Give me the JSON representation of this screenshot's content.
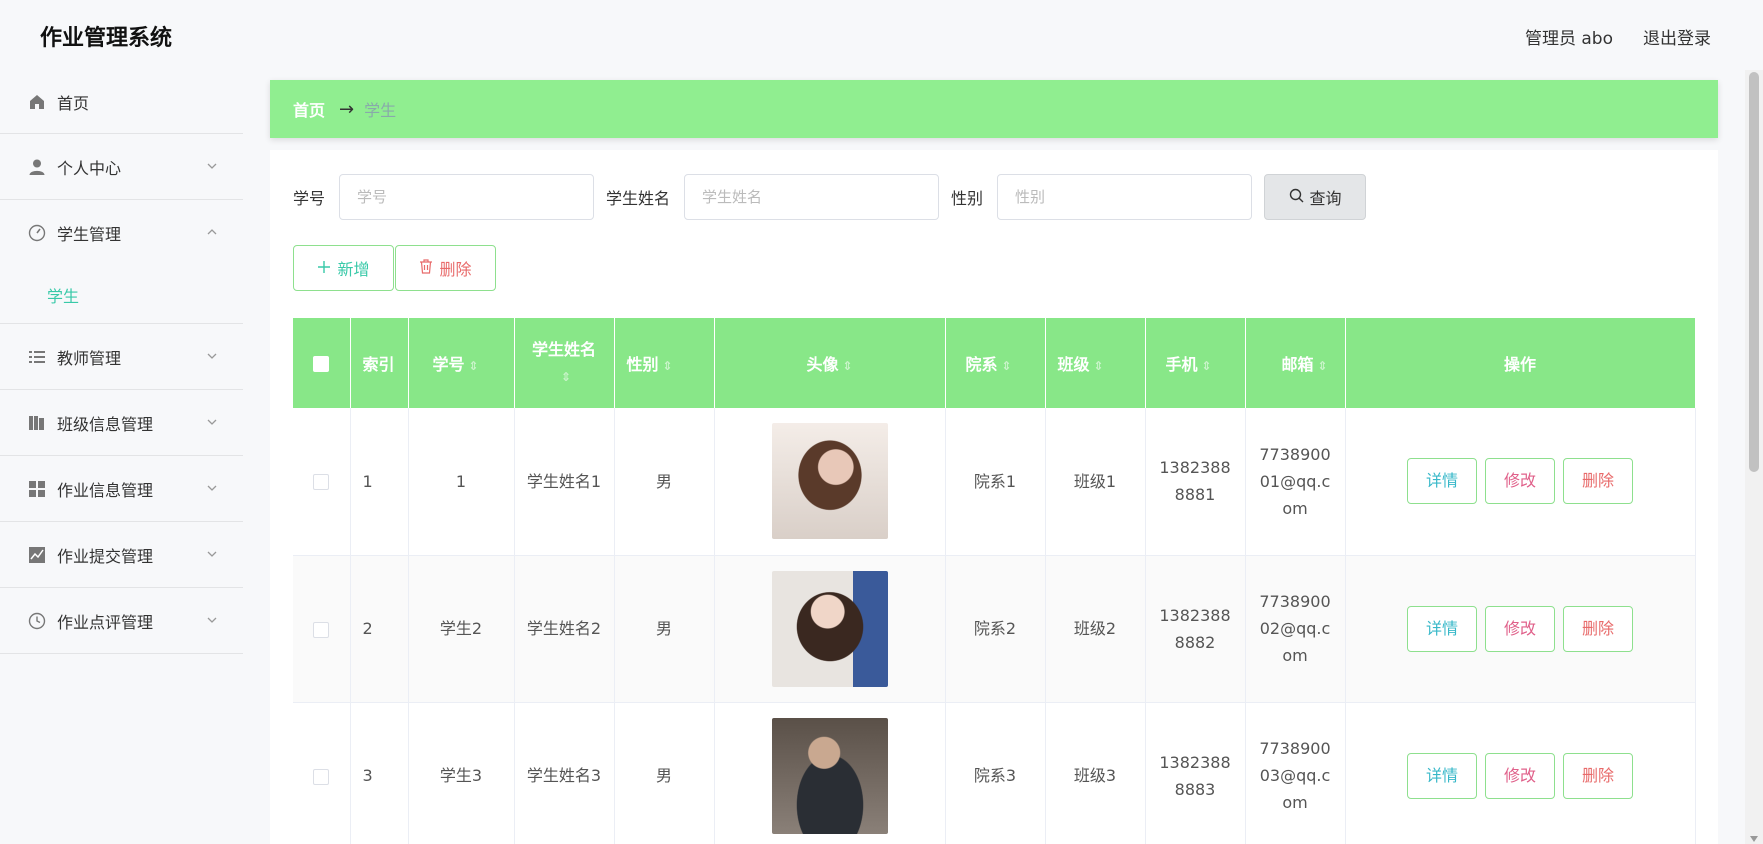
{
  "app": {
    "title": "作业管理系统"
  },
  "header": {
    "user_label": "管理员 abo",
    "logout_label": "退出登录"
  },
  "sidebar": {
    "items": [
      {
        "label": "首页"
      },
      {
        "label": "个人中心"
      },
      {
        "label": "学生管理",
        "children": [
          {
            "label": "学生"
          }
        ]
      },
      {
        "label": "教师管理"
      },
      {
        "label": "班级信息管理"
      },
      {
        "label": "作业信息管理"
      },
      {
        "label": "作业提交管理"
      },
      {
        "label": "作业点评管理"
      }
    ]
  },
  "breadcrumb": {
    "home": "首页",
    "arrow": "→",
    "current": "学生"
  },
  "search": {
    "student_no": {
      "label": "学号",
      "placeholder": "学号",
      "value": ""
    },
    "student_name": {
      "label": "学生姓名",
      "placeholder": "学生姓名",
      "value": ""
    },
    "gender": {
      "label": "性别",
      "placeholder": "性别",
      "value": ""
    },
    "query_label": "查询"
  },
  "actions": {
    "add_label": "新增",
    "delete_label": "删除"
  },
  "table": {
    "headers": [
      "索引",
      "学号",
      "学生姓名",
      "性别",
      "头像",
      "院系",
      "班级",
      "手机",
      "邮箱",
      "操作"
    ],
    "rows": [
      {
        "index": "1",
        "no": "1",
        "name": "学生姓名1",
        "gender": "男",
        "dept": "院系1",
        "class": "班级1",
        "phone": "13823888881",
        "email": "773890001@qq.com"
      },
      {
        "index": "2",
        "no": "学生2",
        "name": "学生姓名2",
        "gender": "男",
        "dept": "院系2",
        "class": "班级2",
        "phone": "13823888882",
        "email": "773890002@qq.com"
      },
      {
        "index": "3",
        "no": "学生3",
        "name": "学生姓名3",
        "gender": "男",
        "dept": "院系3",
        "class": "班级3",
        "phone": "13823888883",
        "email": "773890003@qq.com"
      }
    ],
    "row_actions": {
      "detail": "详情",
      "edit": "修改",
      "delete": "删除"
    }
  },
  "colors": {
    "accent_green": "#90ee90",
    "header_green": "#88e788",
    "teal": "#38c9a8",
    "danger": "#e86a6a"
  }
}
